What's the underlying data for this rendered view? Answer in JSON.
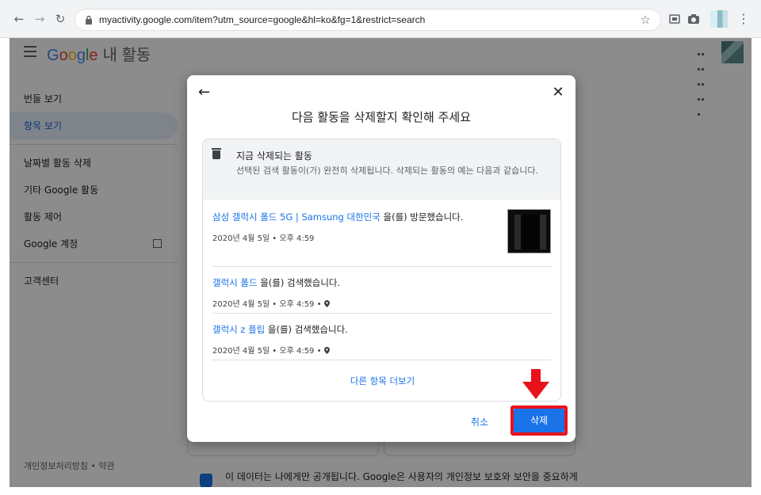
{
  "browser": {
    "url": "myactivity.google.com/item?utm_source=google&hl=ko&fg=1&restrict=search"
  },
  "app": {
    "logo": "Google",
    "title": "내 활동"
  },
  "sidebar": {
    "items": [
      {
        "label": "번들 보기"
      },
      {
        "label": "항목 보기"
      },
      {
        "label": "날짜별 활동 삭제"
      },
      {
        "label": "기타 Google 활동"
      },
      {
        "label": "활동 제어"
      },
      {
        "label": "Google 계정"
      },
      {
        "label": "고객센터"
      }
    ],
    "footer": "개인정보처리방침 • 약관"
  },
  "background": {
    "privacy_notice": "이 데이터는 나에게만 공개됩니다. Google은 사용자의 개인정보 보호와 보안을 중요하게"
  },
  "dialog": {
    "title": "다음 활동을 삭제할지 확인해 주세요",
    "header_title": "지금 삭제되는 활동",
    "header_desc": "선택된 검색 활동이(가) 완전히 삭제됩니다. 삭제되는 활동의 예는 다음과 같습니다.",
    "entries": [
      {
        "link": "삼성 갤럭시 폴드 5G | Samsung 대한민국",
        "suffix": " 을(를) 방문했습니다.",
        "time": "2020년 4월 5일 • 오후 4:59"
      },
      {
        "link": "갤럭시 폴드",
        "suffix": " 을(를) 검색했습니다.",
        "time": "2020년 4월 5일 • 오후 4:59 •"
      },
      {
        "link": "갤럭시 z 플립",
        "suffix": " 을(를) 검색했습니다.",
        "time": "2020년 4월 5일 • 오후 4:59 •"
      }
    ],
    "more_link": "다른 항목 더보기",
    "cancel": "취소",
    "delete": "삭제"
  },
  "colors": {
    "accent": "#1a73e8",
    "highlight": "#e8121a"
  },
  "icons": [
    "back-arrow-icon",
    "reload-icon",
    "lock-icon",
    "star-icon",
    "hamburger-icon",
    "apps-grid-icon",
    "close-icon",
    "trash-icon",
    "location-pin-icon",
    "external-link-icon",
    "down-arrow-annotation-icon"
  ]
}
